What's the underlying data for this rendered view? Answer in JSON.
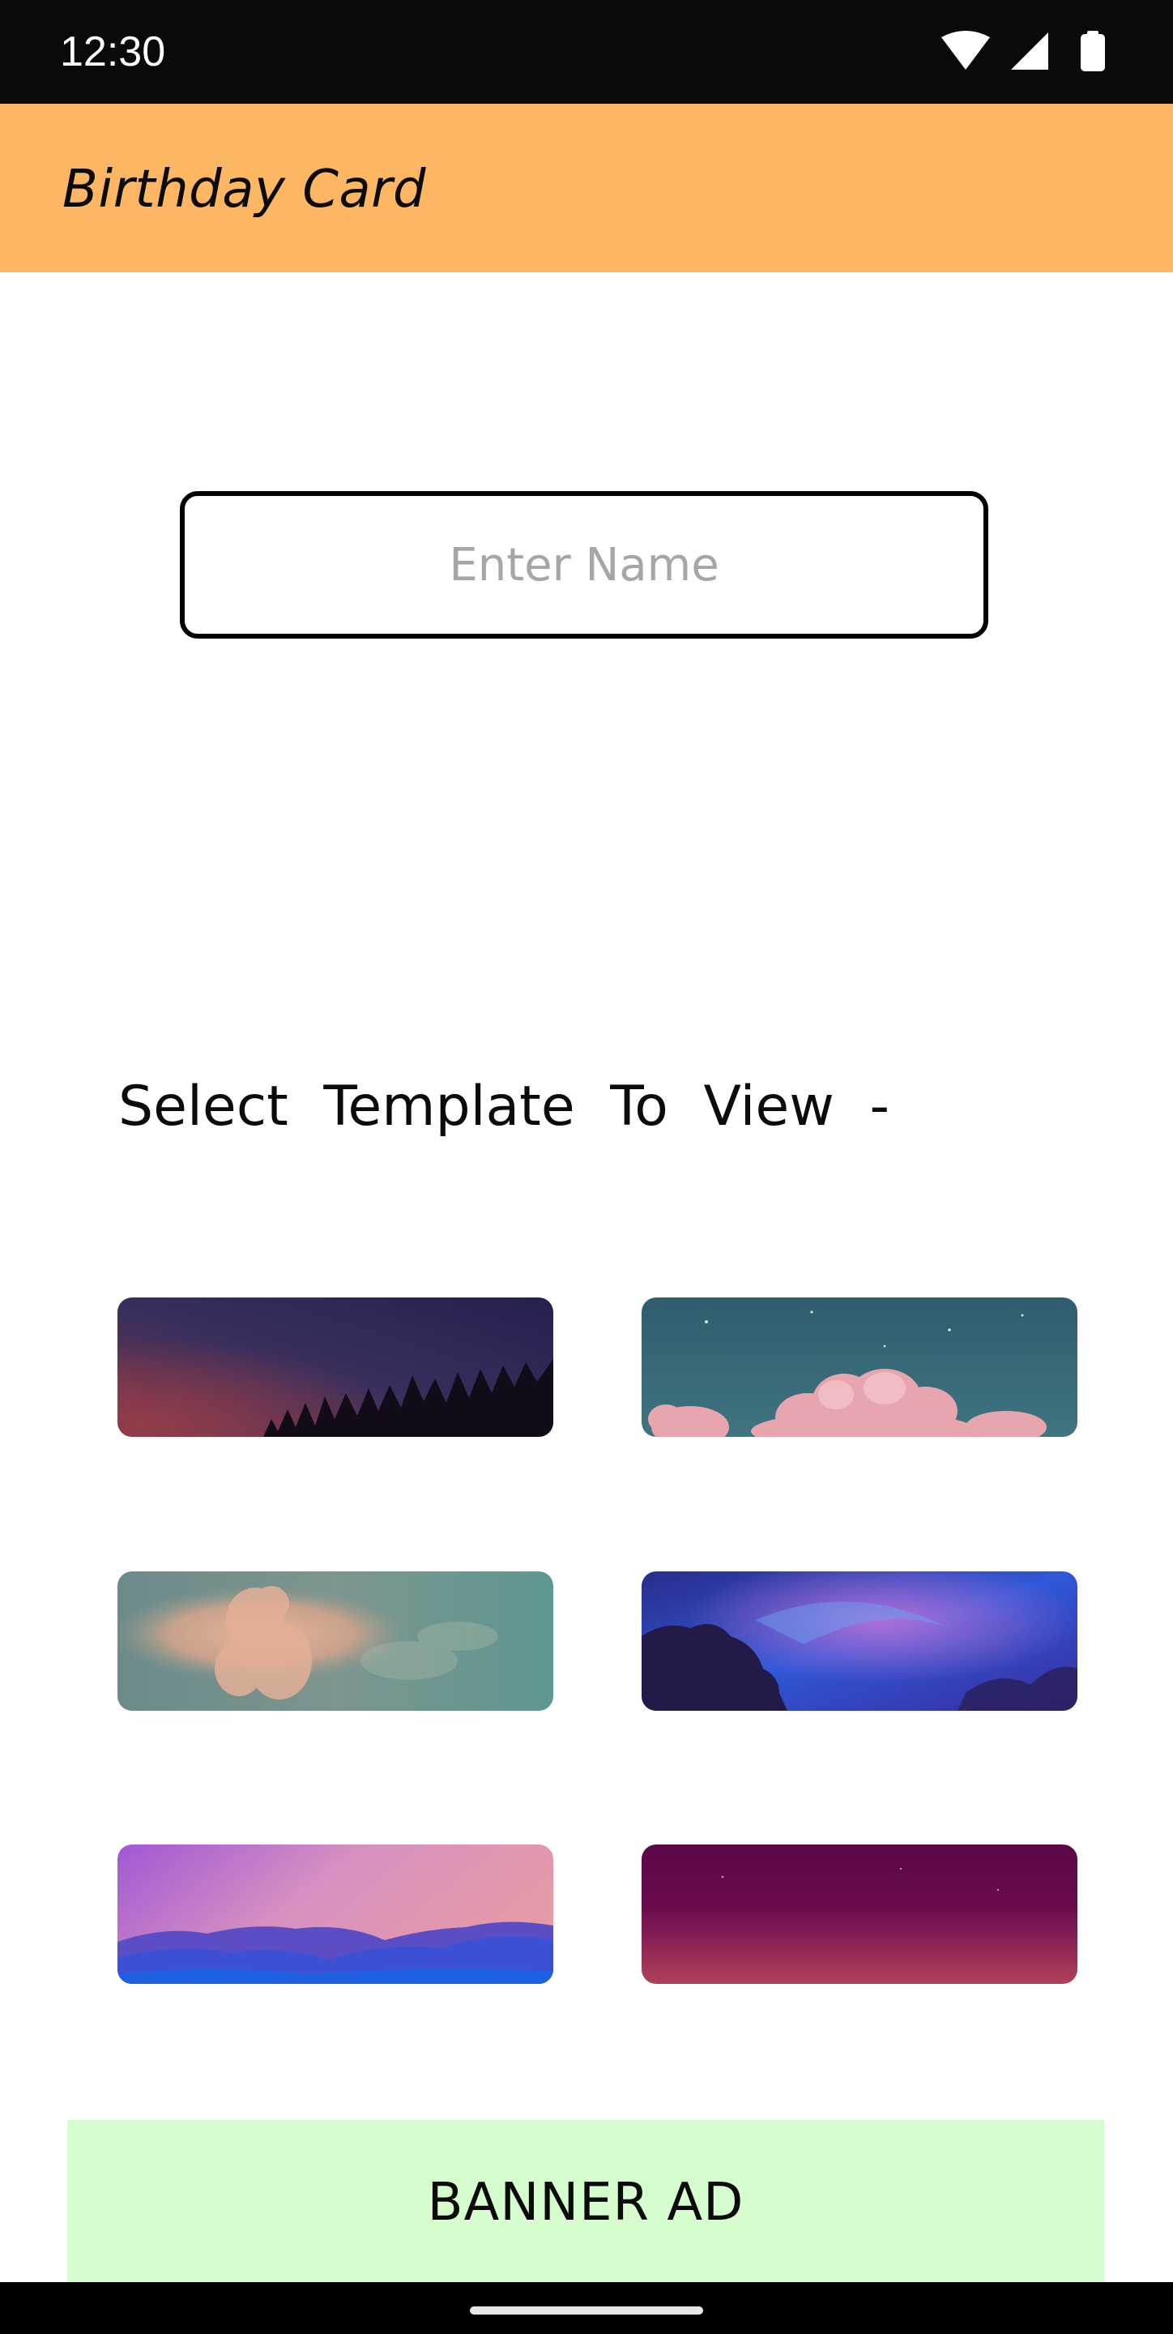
{
  "status_bar": {
    "time": "12:30",
    "icons": [
      "wifi-icon",
      "cellular-signal-icon",
      "battery-icon"
    ]
  },
  "app_bar": {
    "title": "Birthday Card",
    "background": "#fdb662"
  },
  "name_input": {
    "value": "",
    "placeholder": "Enter Name"
  },
  "templates": {
    "heading": "Select  Template  To  View  -",
    "items": [
      "template-twilight-forest",
      "template-teal-sky-pink-clouds",
      "template-sage-cumulus",
      "template-blue-nebula",
      "template-purple-mountains",
      "template-magenta-night"
    ]
  },
  "banner_ad": {
    "label": "BANNER AD",
    "background": "#d6fdcd"
  }
}
